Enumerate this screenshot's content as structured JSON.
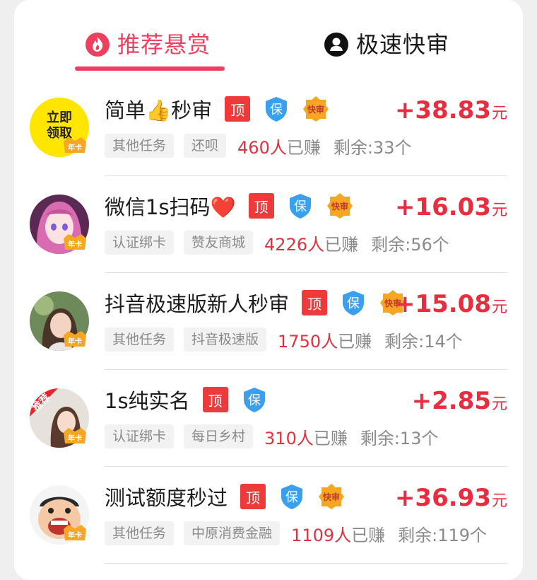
{
  "tabs": {
    "active_label": "推荐悬赏",
    "inactive_label": "极速快审"
  },
  "badges": {
    "top": "顶",
    "guarantee": "保",
    "fast": "快审",
    "nianka": "年卡",
    "recommend": "推荐",
    "promo_line1": "立即",
    "promo_line2": "领取"
  },
  "colors": {
    "accent": "#ee3f5e",
    "price": "#ea2c3e",
    "top_badge": "#ee3a3a",
    "guarantee_badge": "#3aa0ee",
    "fast_badge": "#f5a623"
  },
  "tasks": [
    {
      "title": "简单👍秒审",
      "amount": "+38.83",
      "unit": "元",
      "category": "其他任务",
      "platform": "还呗",
      "earned_count": "460人",
      "earned_suffix": "已赚",
      "remaining": "剩余:33个",
      "avatar": "promo-badge",
      "show_fast": true
    },
    {
      "title": "微信1s扫码❤️",
      "amount": "+16.03",
      "unit": "元",
      "category": "认证绑卡",
      "platform": "赞友商城",
      "earned_count": "4226人",
      "earned_suffix": "已赚",
      "remaining": "剩余:56个",
      "avatar": "anime-girl",
      "show_fast": true
    },
    {
      "title": "抖音极速版新人秒审",
      "amount": "+15.08",
      "unit": "元",
      "category": "其他任务",
      "platform": "抖音极速版",
      "earned_count": "1750人",
      "earned_suffix": "已赚",
      "remaining": "剩余:14个",
      "avatar": "girl-photo",
      "show_fast": true
    },
    {
      "title": "1s纯实名",
      "amount": "+2.85",
      "unit": "元",
      "category": "认证绑卡",
      "platform": "每日乡村",
      "earned_count": "310人",
      "earned_suffix": "已赚",
      "remaining": "剩余:13个",
      "avatar": "recommend-photo",
      "show_fast": false
    },
    {
      "title": "测试额度秒过",
      "amount": "+36.93",
      "unit": "元",
      "category": "其他任务",
      "platform": "中原消费金融",
      "earned_count": "1109人",
      "earned_suffix": "已赚",
      "remaining": "剩余:119个",
      "avatar": "cartoon-man",
      "show_fast": true
    }
  ]
}
